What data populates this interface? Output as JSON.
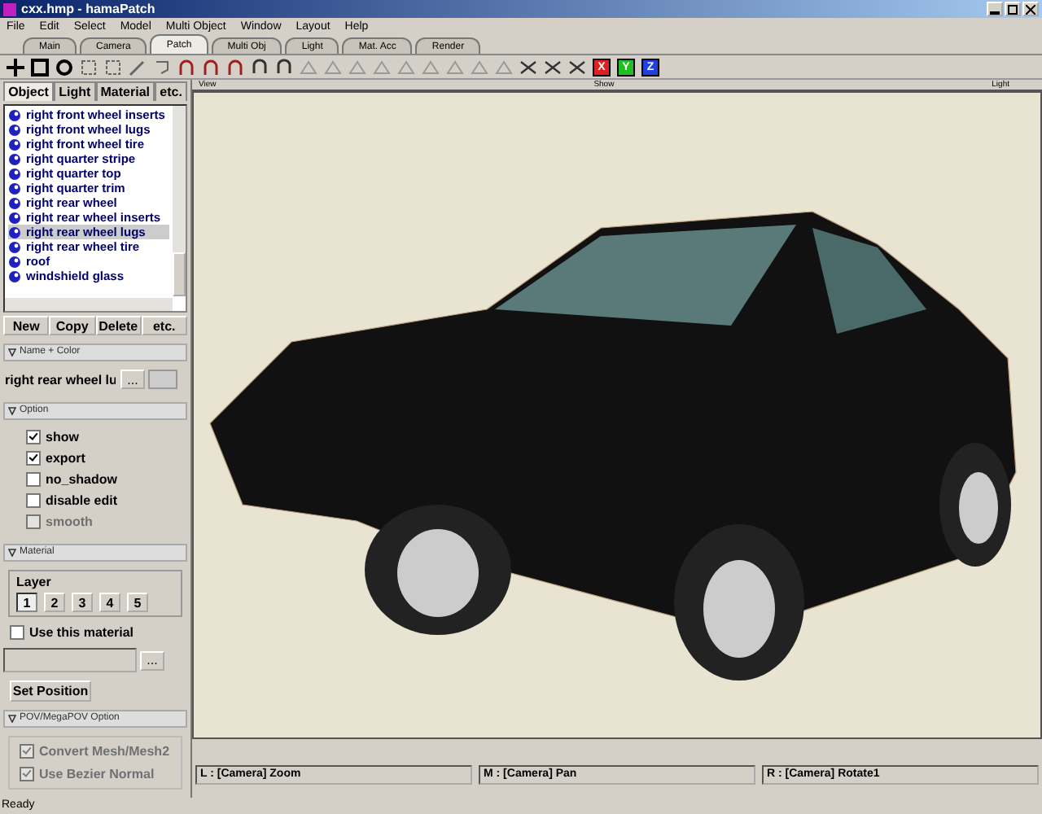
{
  "window": {
    "title": "cxx.hmp - hamaPatch"
  },
  "menu": [
    "File",
    "Edit",
    "Select",
    "Model",
    "Multi Object",
    "Window",
    "Layout",
    "Help"
  ],
  "tabs": [
    {
      "label": "Main",
      "selected": false
    },
    {
      "label": "Camera",
      "selected": false
    },
    {
      "label": "Patch",
      "selected": true
    },
    {
      "label": "Multi Obj",
      "selected": false
    },
    {
      "label": "Light",
      "selected": false
    },
    {
      "label": "Mat. Acc",
      "selected": false
    },
    {
      "label": "Render",
      "selected": false
    }
  ],
  "axis_buttons": [
    {
      "label": "X",
      "color": "#e02020"
    },
    {
      "label": "Y",
      "color": "#20c020"
    },
    {
      "label": "Z",
      "color": "#2040e0"
    }
  ],
  "panel_tabs": [
    {
      "label": "Object",
      "selected": true
    },
    {
      "label": "Light",
      "selected": false
    },
    {
      "label": "Material",
      "selected": false
    },
    {
      "label": "etc.",
      "selected": false
    }
  ],
  "objects": [
    {
      "name": "right front wheel inserts",
      "selected": false
    },
    {
      "name": "right front wheel lugs",
      "selected": false
    },
    {
      "name": "right front wheel tire",
      "selected": false
    },
    {
      "name": "right quarter stripe",
      "selected": false
    },
    {
      "name": "right quarter top",
      "selected": false
    },
    {
      "name": "right quarter trim",
      "selected": false
    },
    {
      "name": "right rear wheel",
      "selected": false
    },
    {
      "name": "right rear wheel inserts",
      "selected": false
    },
    {
      "name": "right rear wheel lugs",
      "selected": true
    },
    {
      "name": "right rear wheel tire",
      "selected": false
    },
    {
      "name": "roof",
      "selected": false
    },
    {
      "name": "windshield glass",
      "selected": false
    }
  ],
  "object_buttons": [
    "New",
    "Copy",
    "Delete",
    "etc."
  ],
  "name_color": {
    "header": "Name + Color",
    "value": "right rear wheel lu",
    "browse": "..."
  },
  "option": {
    "header": "Option",
    "items": [
      {
        "label": "show",
        "checked": true,
        "disabled": false
      },
      {
        "label": "export",
        "checked": true,
        "disabled": false
      },
      {
        "label": "no_shadow",
        "checked": false,
        "disabled": false
      },
      {
        "label": "disable edit",
        "checked": false,
        "disabled": false
      },
      {
        "label": "smooth",
        "checked": false,
        "disabled": true
      }
    ]
  },
  "material": {
    "header": "Material",
    "layer_label": "Layer",
    "layers": [
      {
        "label": "1",
        "selected": true
      },
      {
        "label": "2",
        "selected": false
      },
      {
        "label": "3",
        "selected": false
      },
      {
        "label": "4",
        "selected": false
      },
      {
        "label": "5",
        "selected": false
      }
    ],
    "use_material": {
      "label": "Use this material",
      "checked": false
    },
    "browse": "...",
    "set_position": "Set Position"
  },
  "pov": {
    "header": "POV/MegaPOV Option",
    "items": [
      {
        "label": "Convert Mesh/Mesh2",
        "checked": true,
        "disabled": true
      },
      {
        "label": "Use Bezier Normal",
        "checked": true,
        "disabled": true
      }
    ]
  },
  "viewport": {
    "labels": [
      "View",
      "Show",
      "Light"
    ]
  },
  "mouse_hints": [
    "L : [Camera] Zoom",
    "M : [Camera] Pan",
    "R : [Camera] Rotate1"
  ],
  "status_bar": "Ready"
}
